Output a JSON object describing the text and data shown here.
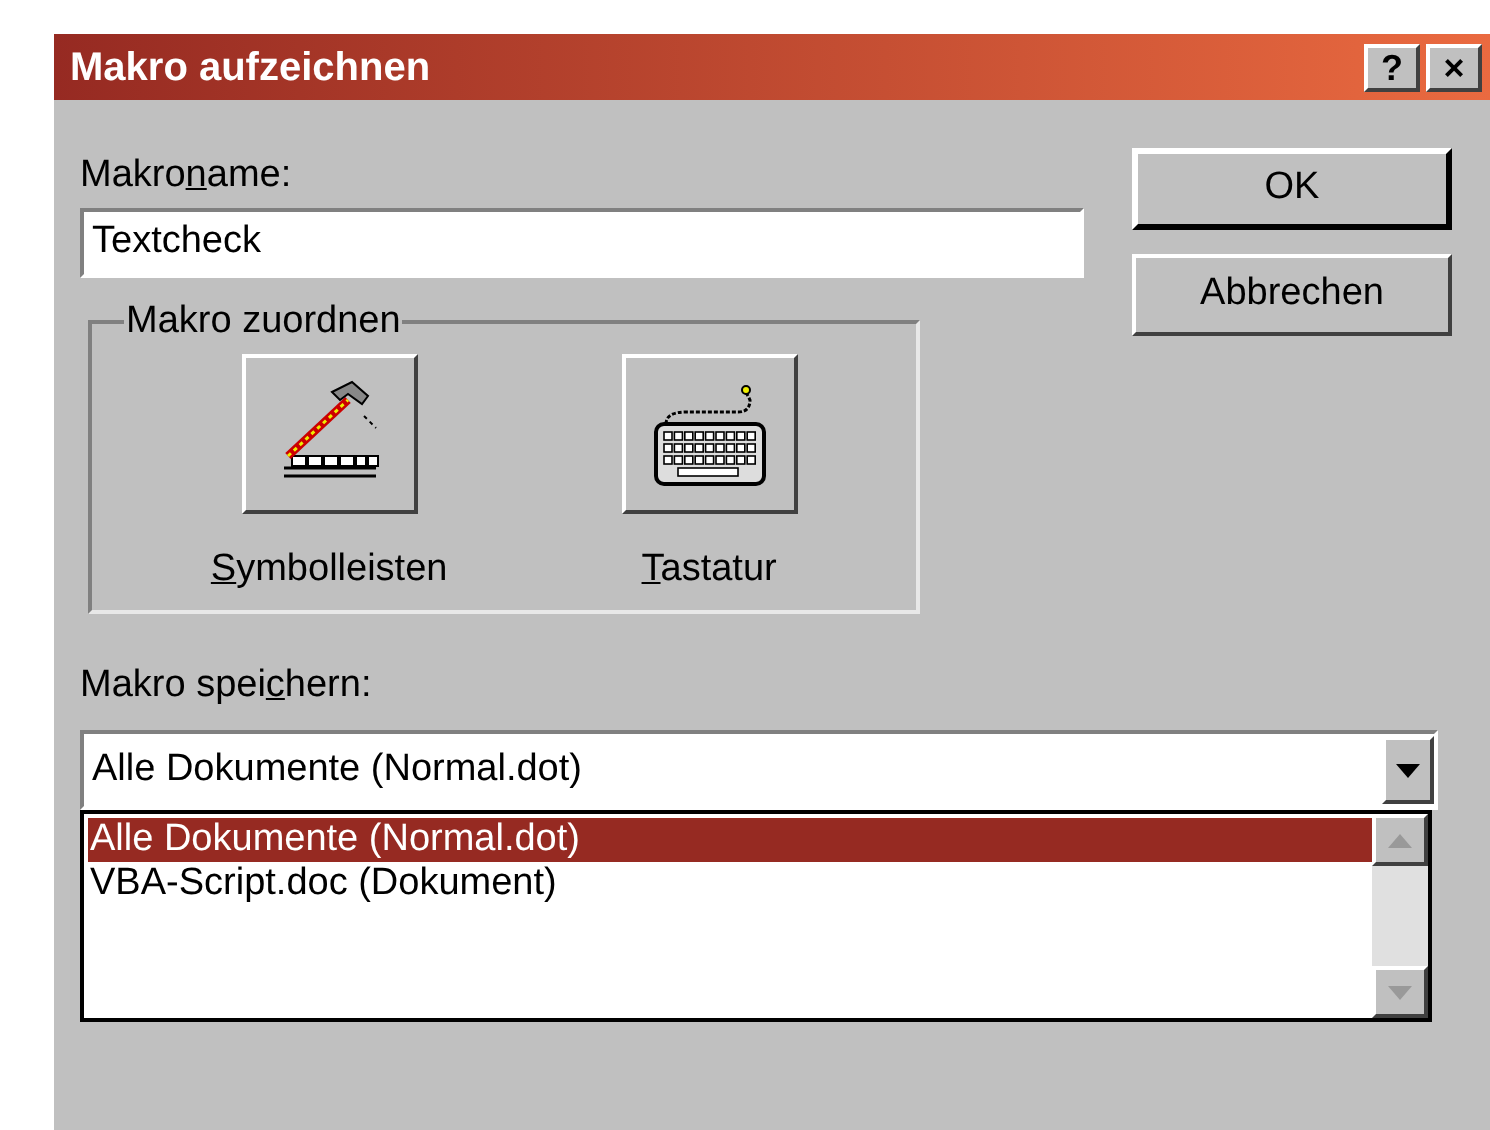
{
  "window": {
    "title": "Makro aufzeichnen",
    "title_buttons": [
      "?",
      "×"
    ]
  },
  "macro_name": {
    "label": {
      "before": "Makro",
      "key": "n",
      "after": "ame:"
    },
    "value": "Textcheck"
  },
  "buttons": [
    "OK",
    "Abbrechen"
  ],
  "assign_group": {
    "title": "Makro zuordnen",
    "items": [
      {
        "kind": "toolbar",
        "label": {
          "key": "S",
          "after": "ymbolleisten"
        }
      },
      {
        "kind": "keyboard",
        "label": {
          "key": "T",
          "after": "astatur"
        }
      }
    ]
  },
  "store": {
    "label": {
      "before": "Makro spei",
      "key": "c",
      "after": "hern:"
    },
    "value": "Alle Dokumente (Normal.dot)",
    "expanded": true,
    "options": [
      {
        "label": "Alle Dokumente (Normal.dot)",
        "selected": true
      },
      {
        "label": "VBA-Script.doc (Dokument)",
        "selected": false
      }
    ]
  }
}
